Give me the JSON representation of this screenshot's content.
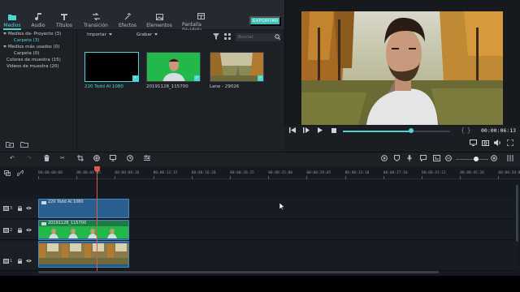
{
  "tabs": [
    {
      "label": "Medios",
      "icon": "folder-icon",
      "active": true
    },
    {
      "label": "Audio",
      "icon": "music-note-icon",
      "active": false
    },
    {
      "label": "Títulos",
      "icon": "text-T-icon",
      "active": false
    },
    {
      "label": "Transición",
      "icon": "transition-icon",
      "active": false
    },
    {
      "label": "Efectos",
      "icon": "effects-icon",
      "active": false
    },
    {
      "label": "Elementos",
      "icon": "image-icon",
      "active": false
    },
    {
      "label": "Pantalla Dividida",
      "icon": "split-screen-icon",
      "active": false
    }
  ],
  "export_label": "EXPORTAR",
  "sidebar": {
    "items": [
      {
        "label": "Medios de- Proyecto (3)",
        "caret": true,
        "selected": false
      },
      {
        "label": "Carpeta (3)",
        "caret": false,
        "selected": true
      },
      {
        "label": "Medios más usados (0)",
        "caret": true,
        "selected": false
      },
      {
        "label": "Carpeta (0)",
        "caret": false,
        "selected": false
      },
      {
        "label": "Colores de muestra (15)",
        "caret": false,
        "selected": false
      },
      {
        "label": "Videos de muestra (20)",
        "caret": false,
        "selected": false
      }
    ]
  },
  "media": {
    "import_label": "Importar",
    "record_label": "Grabar",
    "search_placeholder": "Buscar",
    "items": [
      {
        "name": "220 Todd AI 1080",
        "highlighted": true
      },
      {
        "name": "20191128_115700",
        "highlighted": false
      },
      {
        "name": "Lane - 29026",
        "highlighted": false
      }
    ]
  },
  "player": {
    "timecode": "00:00:06:13",
    "progress": 0.64
  },
  "ruler": {
    "labels": [
      "00:00:00:00",
      "00:00:04:05",
      "00:00:08:10",
      "00:00:12:15",
      "00:00:16:20",
      "00:00:20:25",
      "00:00:25:00",
      "00:00:29:05",
      "00:00:33:10",
      "00:00:37:16",
      "00:00:41:21",
      "00:00:45:26",
      "00:00:50:01"
    ]
  },
  "tracks": [
    {
      "number": "3",
      "clip_label": "220 Todd AI 1080"
    },
    {
      "number": "2",
      "clip_label": "20191128_115700"
    },
    {
      "number": "1",
      "clip_label": ""
    }
  ],
  "colors": {
    "accent": "#4fd4d4",
    "playhead": "#e05a4a",
    "export": "#3ec2b7"
  }
}
